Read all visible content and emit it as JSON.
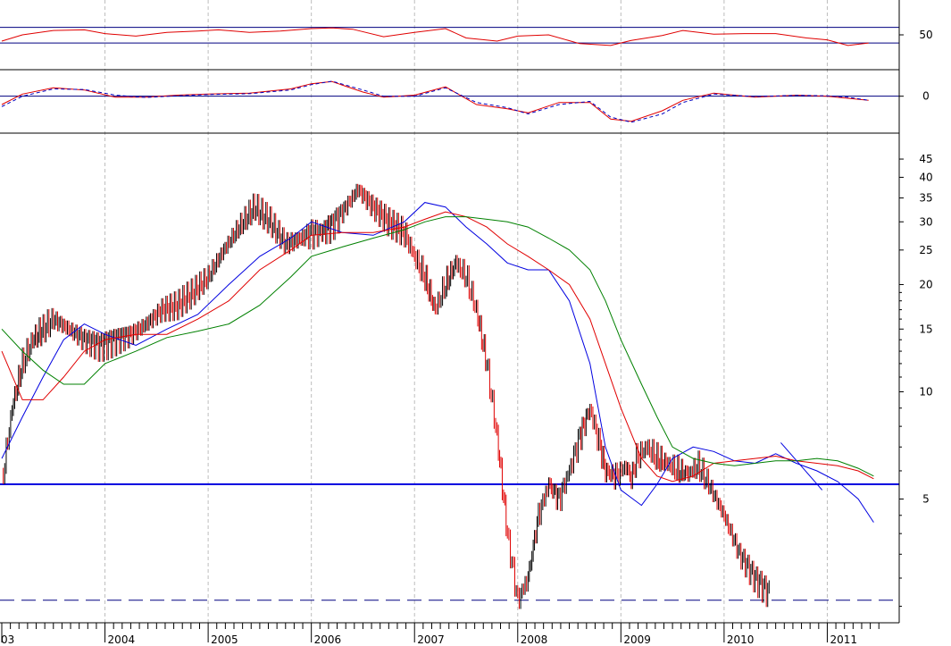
{
  "chart_data": {
    "type": "stock-chart",
    "x_axis": {
      "labels": [
        "03",
        "2004",
        "2005",
        "2006",
        "2007",
        "2008",
        "2009",
        "2010",
        "2011"
      ]
    },
    "panels": [
      {
        "name": "rsi",
        "y_ticks": [
          "50"
        ],
        "ylim": [
          0,
          100
        ],
        "reference_lines": [
          {
            "value": 62,
            "color": "#000080"
          },
          {
            "value": 37,
            "color": "#000080"
          }
        ],
        "series": [
          {
            "color": "#e00000",
            "t": [
              2003.0,
              2003.2,
              2003.5,
              2003.8,
              2004.0,
              2004.3,
              2004.6,
              2004.9,
              2005.1,
              2005.4,
              2005.7,
              2006.0,
              2006.2,
              2006.4,
              2006.7,
              2007.0,
              2007.3,
              2007.5,
              2007.8,
              2008.0,
              2008.3,
              2008.6,
              2008.9,
              2009.1,
              2009.4,
              2009.6,
              2009.9,
              2010.2,
              2010.5,
              2010.8,
              2011.0,
              2011.2,
              2011.4
            ],
            "v": [
              40,
              50,
              57,
              58,
              52,
              48,
              54,
              56,
              58,
              54,
              56,
              60,
              61,
              59,
              47,
              54,
              60,
              45,
              40,
              48,
              50,
              36,
              33,
              41,
              49,
              57,
              51,
              52,
              52,
              45,
              42,
              33,
              37
            ]
          }
        ]
      },
      {
        "name": "macd",
        "y_ticks": [
          "0"
        ],
        "ylim": [
          -1.6,
          1.1
        ],
        "reference_lines": [
          {
            "value": 0,
            "color": "#000080"
          }
        ],
        "series": [
          {
            "color": "#e00000",
            "style": "solid",
            "t": [
              2003.0,
              2003.2,
              2003.5,
              2003.8,
              2004.1,
              2004.4,
              2004.7,
              2005.0,
              2005.4,
              2005.8,
              2006.0,
              2006.2,
              2006.5,
              2006.7,
              2007.0,
              2007.3,
              2007.6,
              2007.9,
              2008.1,
              2008.4,
              2008.7,
              2008.9,
              2009.1,
              2009.4,
              2009.6,
              2009.9,
              2010.3,
              2010.7,
              2011.0,
              2011.2,
              2011.4
            ],
            "v": [
              -0.4,
              0.1,
              0.4,
              0.3,
              -0.05,
              -0.05,
              0.05,
              0.1,
              0.15,
              0.35,
              0.6,
              0.7,
              0.2,
              -0.05,
              0.05,
              0.45,
              -0.4,
              -0.6,
              -0.8,
              -0.3,
              -0.3,
              -1.1,
              -1.2,
              -0.7,
              -0.2,
              0.15,
              -0.05,
              0.05,
              0.0,
              -0.1,
              -0.2
            ]
          },
          {
            "color": "#0000c0",
            "style": "dashed",
            "t": [
              2003.0,
              2003.2,
              2003.5,
              2003.8,
              2004.1,
              2004.4,
              2004.7,
              2005.0,
              2005.4,
              2005.8,
              2006.0,
              2006.2,
              2006.5,
              2006.7,
              2007.0,
              2007.3,
              2007.6,
              2007.9,
              2008.1,
              2008.4,
              2008.7,
              2008.9,
              2009.1,
              2009.4,
              2009.6,
              2009.9,
              2010.3,
              2010.7,
              2011.0,
              2011.2,
              2011.4
            ],
            "v": [
              -0.5,
              0.0,
              0.35,
              0.32,
              0.05,
              -0.06,
              0.02,
              0.08,
              0.12,
              0.3,
              0.55,
              0.72,
              0.3,
              0.0,
              0.0,
              0.4,
              -0.3,
              -0.55,
              -0.85,
              -0.4,
              -0.25,
              -1.0,
              -1.25,
              -0.85,
              -0.3,
              0.1,
              -0.02,
              0.04,
              0.02,
              -0.05,
              -0.2
            ]
          }
        ]
      },
      {
        "name": "price",
        "scale": "log",
        "y_ticks": [
          "45",
          "40",
          "35",
          "30",
          "25",
          "20",
          "15",
          "10",
          "5"
        ],
        "y_tick_values": [
          45,
          40,
          35,
          30,
          25,
          20,
          15,
          10,
          5
        ],
        "ylim": [
          2.3,
          52
        ],
        "reference_lines": [
          {
            "value": 5.5,
            "color": "#0000e0",
            "style": "solid"
          },
          {
            "value": 2.6,
            "color": "#000080",
            "style": "dashed"
          }
        ],
        "price": {
          "color_up": "#000000",
          "color_down": "#e00000",
          "t": [
            2003.0,
            2003.1,
            2003.2,
            2003.3,
            2003.4,
            2003.5,
            2003.65,
            2003.8,
            2003.95,
            2004.1,
            2004.25,
            2004.4,
            2004.55,
            2004.7,
            2004.85,
            2005.0,
            2005.15,
            2005.3,
            2005.45,
            2005.6,
            2005.75,
            2005.9,
            2006.0,
            2006.1,
            2006.2,
            2006.3,
            2006.45,
            2006.6,
            2006.75,
            2006.9,
            2007.0,
            2007.1,
            2007.2,
            2007.3,
            2007.4,
            2007.5,
            2007.6,
            2007.7,
            2007.8,
            2007.9,
            2008.0,
            2008.1,
            2008.2,
            2008.3,
            2008.4,
            2008.5,
            2008.6,
            2008.7,
            2008.8,
            2008.85,
            2008.95,
            2009.05,
            2009.1,
            2009.15,
            2009.25,
            2009.35,
            2009.45,
            2009.55,
            2009.65,
            2009.75,
            2009.85,
            2010.0,
            2010.15,
            2010.3,
            2010.45,
            2010.6,
            2010.75,
            2010.9,
            2011.0,
            2011.05,
            2011.1,
            2011.2,
            2011.3,
            2011.4,
            2011.45
          ],
          "v": [
            5.5,
            9,
            12,
            14,
            15,
            16,
            15,
            14,
            13.5,
            14,
            14.5,
            15.5,
            17,
            17.5,
            19,
            21,
            25,
            29,
            33,
            30,
            26,
            27,
            28,
            28,
            29.5,
            32,
            37,
            33,
            30,
            28,
            24,
            21,
            17,
            20,
            23,
            21,
            17,
            12,
            7.5,
            4,
            2.6,
            3,
            4.5,
            5.5,
            5,
            6,
            7.5,
            9,
            7,
            6,
            5.8,
            6.2,
            5.7,
            6.5,
            7,
            6.5,
            6.3,
            6.0,
            5.9,
            6.2,
            5.5,
            4.5,
            3.5,
            3.0,
            2.7
          ]
        },
        "moving_averages": [
          {
            "color": "#0000e0",
            "t": [
              2003.0,
              2003.2,
              2003.4,
              2003.6,
              2003.8,
              2004.0,
              2004.3,
              2004.6,
              2004.9,
              2005.2,
              2005.5,
              2005.8,
              2006.0,
              2006.3,
              2006.6,
              2006.9,
              2007.1,
              2007.3,
              2007.5,
              2007.7,
              2007.9,
              2008.1,
              2008.3,
              2008.5,
              2008.7,
              2008.85,
              2009.0,
              2009.2,
              2009.35,
              2009.5,
              2009.7,
              2009.9,
              2010.1,
              2010.3,
              2010.5,
              2010.7,
              2010.9,
              2011.1,
              2011.3,
              2011.45
            ],
            "v": [
              6.5,
              8.5,
              11,
              14,
              15.5,
              14.5,
              13.5,
              15,
              16.5,
              20,
              24,
              27,
              30,
              28,
              27.5,
              30,
              34,
              33,
              29,
              26,
              23,
              22,
              22,
              18,
              12,
              7,
              5.3,
              4.8,
              5.5,
              6.5,
              7,
              6.8,
              6.4,
              6.3,
              6.7,
              6.3,
              6.0,
              5.6,
              5.0,
              4.3
            ]
          },
          {
            "color": "#e00000",
            "t": [
              2003.0,
              2003.2,
              2003.4,
              2003.6,
              2003.8,
              2004.0,
              2004.3,
              2004.6,
              2004.9,
              2005.2,
              2005.5,
              2005.8,
              2006.0,
              2006.3,
              2006.6,
              2006.9,
              2007.1,
              2007.3,
              2007.5,
              2007.7,
              2007.9,
              2008.1,
              2008.3,
              2008.5,
              2008.7,
              2008.85,
              2009.0,
              2009.2,
              2009.35,
              2009.5,
              2009.7,
              2009.9,
              2010.1,
              2010.3,
              2010.5,
              2010.7,
              2010.9,
              2011.1,
              2011.3,
              2011.45
            ],
            "v": [
              13,
              9.5,
              9.5,
              11,
              13,
              14,
              14.5,
              14.5,
              16,
              18,
              22,
              25,
              27.5,
              28,
              28,
              29,
              30.5,
              32,
              31,
              29,
              26,
              24,
              22,
              20,
              16,
              12,
              9,
              6.5,
              5.8,
              5.6,
              5.8,
              6.3,
              6.4,
              6.5,
              6.6,
              6.4,
              6.3,
              6.2,
              6.0,
              5.7
            ]
          },
          {
            "color": "#008000",
            "t": [
              2003.0,
              2003.2,
              2003.4,
              2003.6,
              2003.8,
              2004.0,
              2004.3,
              2004.6,
              2004.9,
              2005.2,
              2005.5,
              2005.8,
              2006.0,
              2006.3,
              2006.6,
              2006.9,
              2007.1,
              2007.3,
              2007.5,
              2007.7,
              2007.9,
              2008.1,
              2008.3,
              2008.5,
              2008.7,
              2008.85,
              2009.0,
              2009.2,
              2009.35,
              2009.5,
              2009.7,
              2009.9,
              2010.1,
              2010.3,
              2010.5,
              2010.7,
              2010.9,
              2011.1,
              2011.3,
              2011.45
            ],
            "v": [
              15,
              13,
              11.5,
              10.5,
              10.5,
              12,
              13,
              14.2,
              14.8,
              15.5,
              17.5,
              21,
              24,
              25.5,
              27,
              28.5,
              30,
              31,
              31,
              30.5,
              30,
              29,
              27,
              25,
              22,
              18,
              14,
              10.5,
              8.5,
              7,
              6.5,
              6.3,
              6.2,
              6.3,
              6.4,
              6.4,
              6.5,
              6.4,
              6.1,
              5.8
            ]
          },
          {
            "color": "#0000e0",
            "style": "trendline",
            "t": [
              2010.55,
              2010.95
            ],
            "v": [
              7.2,
              5.3
            ]
          }
        ]
      }
    ],
    "grid": "vertical-dashed"
  }
}
